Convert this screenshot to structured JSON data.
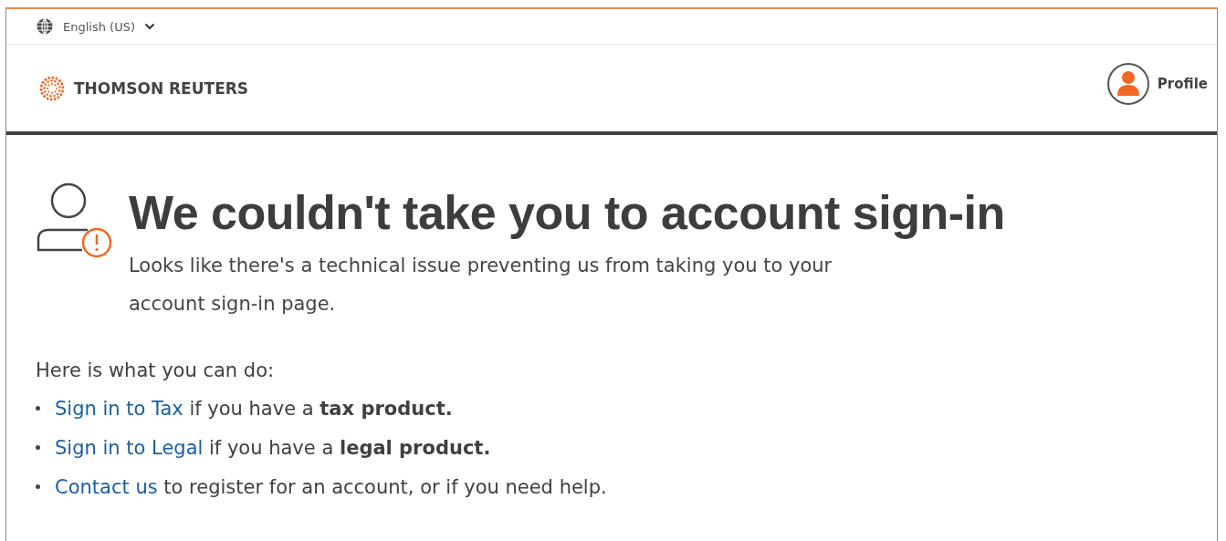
{
  "language_selector": {
    "label": "English (US)"
  },
  "header": {
    "logo_text": "THOMSON REUTERS",
    "profile_label": "Profile"
  },
  "error": {
    "title": "We couldn't take you to account sign-in",
    "message": "Looks like there's a technical issue preventing us from taking you to your account sign-in page."
  },
  "help": {
    "intro": "Here is what you can do:",
    "items": [
      {
        "link": "Sign in to Tax",
        "text": " if you have a **tax product.**"
      },
      {
        "link": "Sign in to Legal",
        "text": " if you have a **legal product.**"
      },
      {
        "link": "Contact us",
        "text": " to register for an account, or if you need help."
      }
    ]
  }
}
